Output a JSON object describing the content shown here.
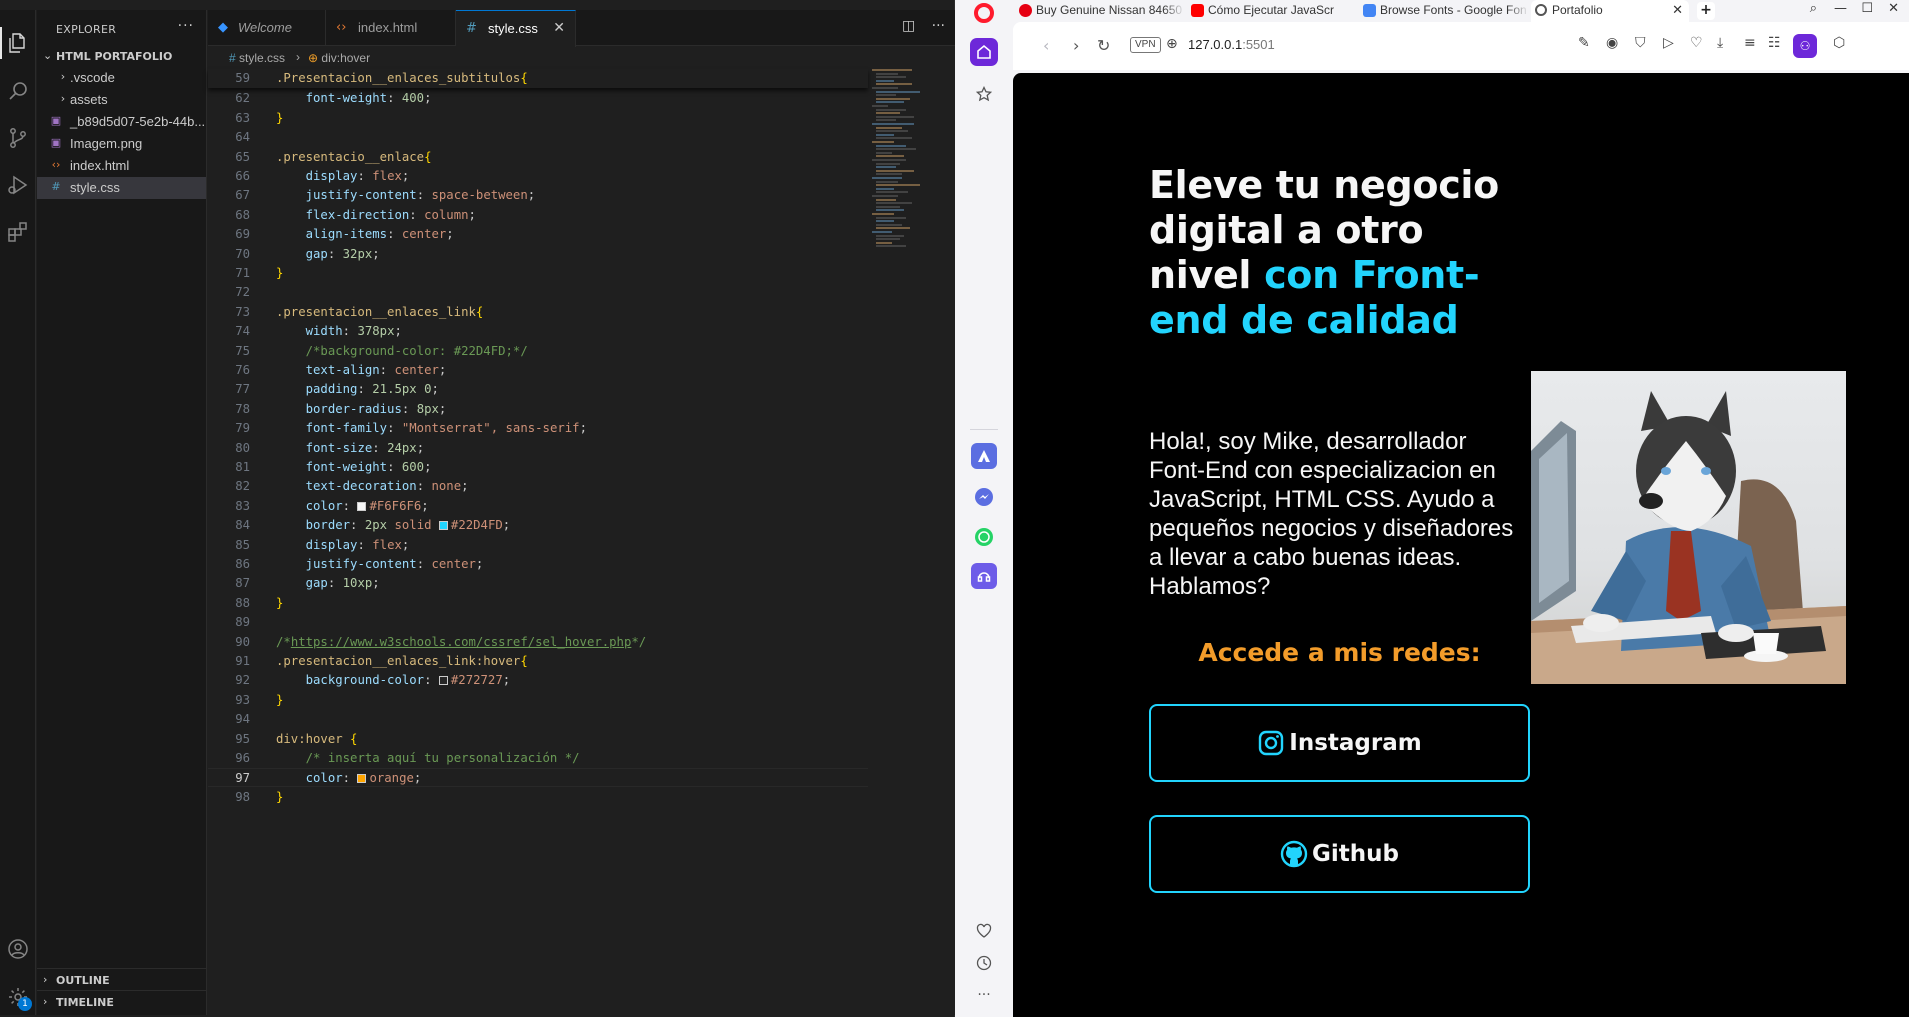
{
  "vscode": {
    "explorer_title": "EXPLORER",
    "folder_name": "HTML PORTAFOLIO",
    "tree": [
      {
        "label": ".vscode",
        "type": "folder"
      },
      {
        "label": "assets",
        "type": "folder"
      },
      {
        "label": "_b89d5d07-5e2b-44b...",
        "type": "image"
      },
      {
        "label": "Imagem.png",
        "type": "image"
      },
      {
        "label": "index.html",
        "type": "html"
      },
      {
        "label": "style.css",
        "type": "css"
      }
    ],
    "outline_label": "OUTLINE",
    "timeline_label": "TIMELINE",
    "manage_badge": "1",
    "tabs": [
      {
        "label": "Welcome"
      },
      {
        "label": "index.html"
      },
      {
        "label": "style.css"
      }
    ],
    "breadcrumb": {
      "file": "style.css",
      "symbol": "div:hover"
    }
  },
  "browser": {
    "tabs": [
      {
        "label": "Buy Genuine Nissan 84650"
      },
      {
        "label": "Cómo Ejecutar JavaScr"
      },
      {
        "label": "Browse Fonts - Google Fon"
      },
      {
        "label": "Portafolio"
      }
    ],
    "vpn": "VPN",
    "url_host": "127.0.0.1",
    "url_port": ":5501"
  },
  "page": {
    "title_plain": "Eleve tu negocio digital a otro nivel ",
    "title_accent": "con Front-end de calidad",
    "intro": "Hola!, soy Mike, desarrollador Font-End con especializacion en JavaScript, HTML CSS. Ayudo a pequeños negocios y diseñadores a llevar a cabo buenas ideas. Hablamos?",
    "socials_title": "Accede a mis redes:",
    "instagram_label": "Instagram",
    "github_label": "Github"
  },
  "colors": {
    "accent": "#22D4FD",
    "text": "#F6F6F6",
    "orange": "#F39C2A"
  }
}
